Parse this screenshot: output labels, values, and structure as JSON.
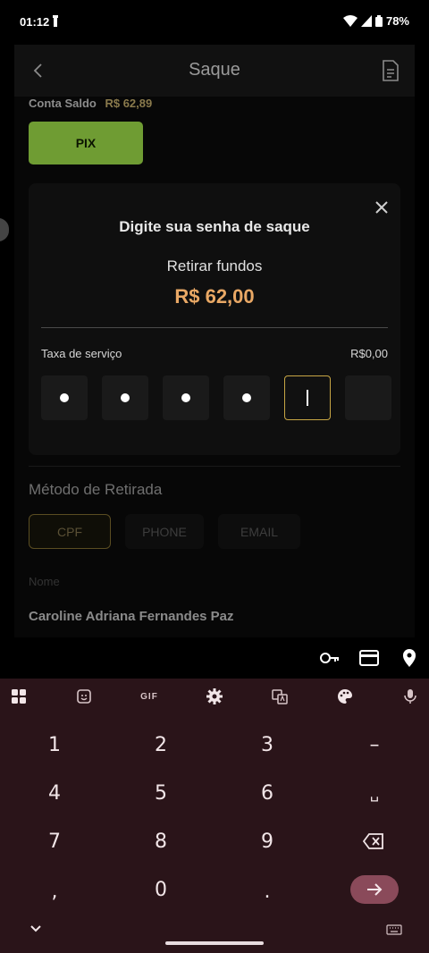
{
  "status_bar": {
    "time": "01:12",
    "battery": "78%"
  },
  "header": {
    "title": "Saque"
  },
  "balance": {
    "label": "Conta Saldo",
    "amount": "R$ 62,89"
  },
  "pix_button": {
    "label": "PIX"
  },
  "modal": {
    "title": "Digite sua senha de saque",
    "subtitle": "Retirar fundos",
    "amount": "R$  62,00",
    "fee_label": "Taxa de serviço",
    "fee_value": "R$0,00",
    "pin_filled": 4,
    "pin_length": 6
  },
  "method": {
    "title": "Método de Retirada",
    "tabs": [
      {
        "label": "CPF",
        "active": true
      },
      {
        "label": "PHONE",
        "active": false
      },
      {
        "label": "EMAIL",
        "active": false
      }
    ]
  },
  "name_field": {
    "label": "Nome",
    "value": "Caroline Adriana Fernandes Paz"
  },
  "autofill": {
    "icons": [
      "key-icon",
      "credit-card-icon",
      "location-pin-icon"
    ]
  },
  "keyboard": {
    "toolbar": {
      "gif_label": "GIF"
    },
    "keys": {
      "row1": [
        "1",
        "2",
        "3",
        "–"
      ],
      "row2": [
        "4",
        "5",
        "6",
        "␣"
      ],
      "row3": [
        "7",
        "8",
        "9"
      ],
      "row4": [
        ",",
        "0",
        "."
      ]
    }
  },
  "colors": {
    "accent_gold": "#c7a645",
    "amount_orange": "#e9a865",
    "pix_green": "#6f9c33",
    "keyboard_bg": "#2a1419",
    "enter_key": "#8a4a5a"
  }
}
